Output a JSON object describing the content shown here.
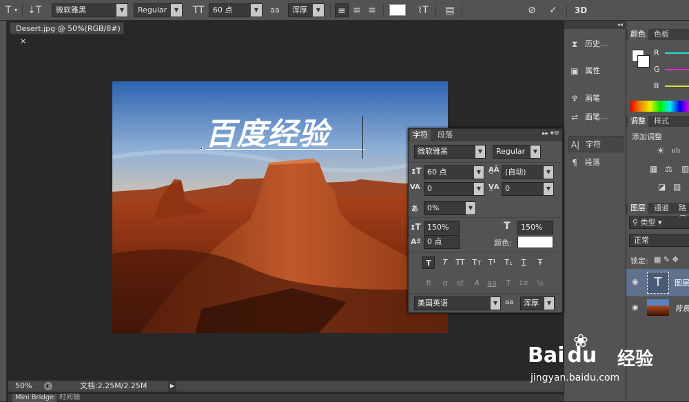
{
  "options_bar": {
    "font_family": "微软雅黑",
    "font_style": "Regular",
    "font_size": "60 点",
    "antialias": "浑厚",
    "aa_label": "a",
    "three_d": "3D",
    "color_swatch": "#ffffff"
  },
  "document": {
    "tab_title": "Desert.jpg @ 50%(RGB/8#)",
    "close": "×",
    "overlay_text": "百度经验",
    "zoom": "50%",
    "doc_info": "文档:2.25M/2.25M",
    "bottom_tabs": [
      "Mini Bridge",
      "时间轴"
    ]
  },
  "dock_items": [
    {
      "label": "历史...",
      "icon": "history-icon"
    },
    {
      "label": "属性",
      "icon": "properties-icon"
    },
    {
      "label": "画笔",
      "icon": "brush-icon"
    },
    {
      "label": "画笔...",
      "icon": "brush-presets-icon"
    },
    {
      "label": "字符",
      "icon": "character-icon"
    },
    {
      "label": "段落",
      "icon": "paragraph-icon"
    }
  ],
  "color_panel": {
    "tabs": [
      "颜色",
      "色板"
    ],
    "channels": [
      "R",
      "G",
      "B"
    ],
    "fg": "#ffffff",
    "bg": "#ffffff"
  },
  "adjust_panel": {
    "tabs": [
      "调整",
      "样式"
    ],
    "title": "添加调整"
  },
  "layers_panel": {
    "tabs": [
      "图层",
      "通道",
      "路径"
    ],
    "kind_filter": "类型",
    "blend_mode": "正常",
    "lock_label": "锁定:",
    "layers": [
      {
        "name": "图层",
        "type": "text"
      },
      {
        "name": "背景",
        "type": "image"
      }
    ]
  },
  "character_panel": {
    "tabs": [
      "字符",
      "段落"
    ],
    "font_family": "微软雅黑",
    "font_style": "Regular",
    "size": "60 点",
    "leading": "(自动)",
    "kerning": "0",
    "tracking": "0",
    "tsume": "0%",
    "vertical_scale": "150%",
    "horizontal_scale": "150%",
    "baseline_shift": "0 点",
    "color_label": "颜色:",
    "color": "#ffffff",
    "language": "美国英语",
    "antialias": "浑厚",
    "aa_label": "a",
    "style_buttons": [
      "T",
      "T",
      "TT",
      "Tт",
      "T¹",
      "T₁",
      "T",
      "Ŧ"
    ],
    "opentype_buttons": [
      "fi",
      "ơ",
      "st",
      "A",
      "aa",
      "T",
      "1st",
      "½"
    ]
  },
  "watermark": {
    "brand": "Bai",
    "brand2": "du",
    "cn": "经验",
    "url": "jingyan.baidu.com"
  }
}
